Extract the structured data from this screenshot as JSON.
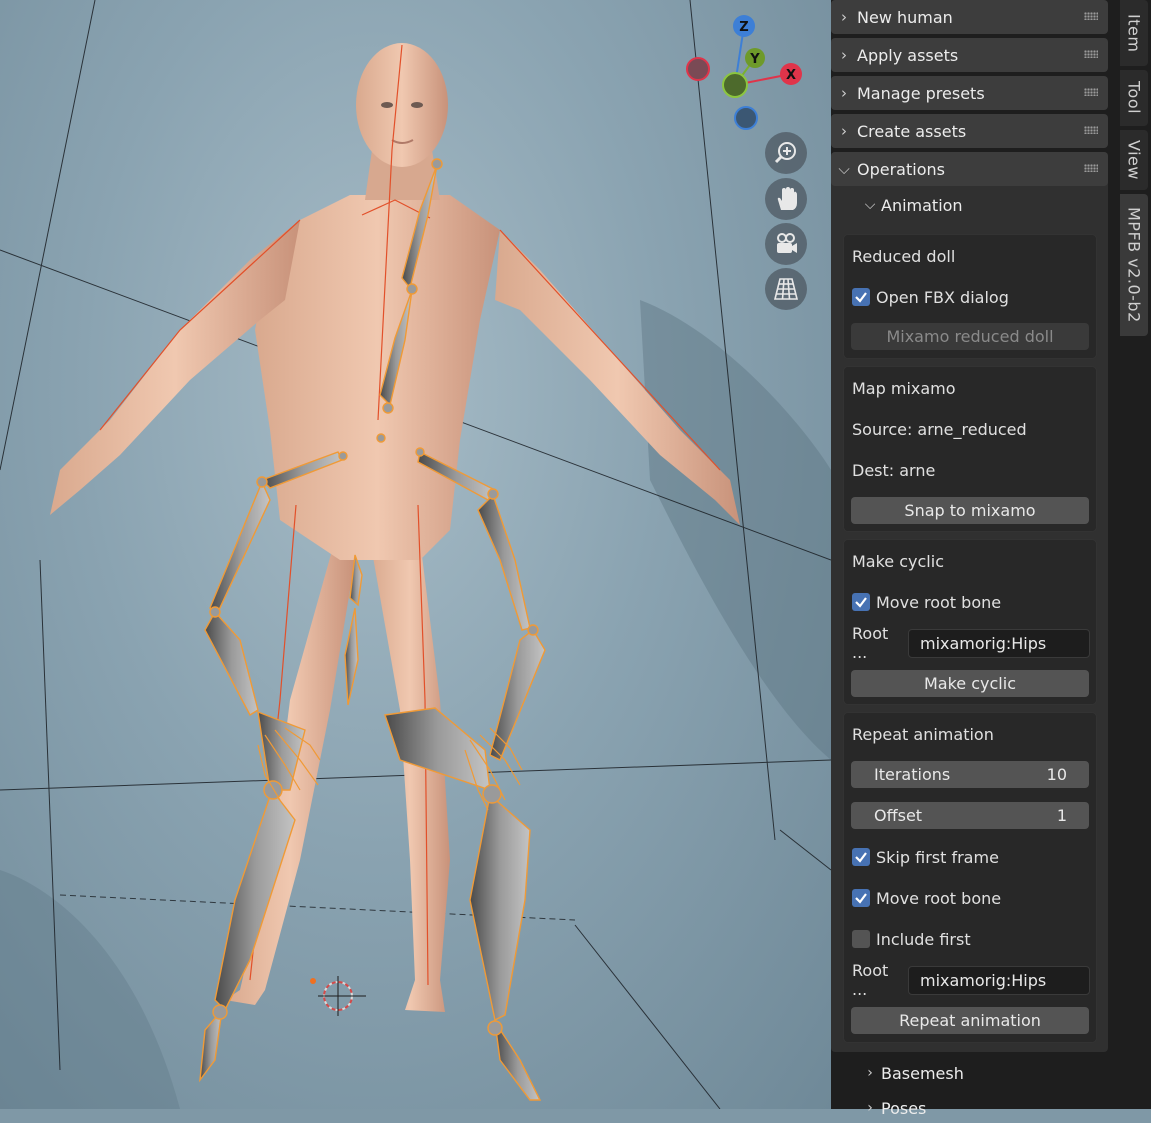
{
  "viewport": {
    "gizmo": {
      "z": "Z",
      "y": "Y",
      "x": "X"
    },
    "nav_icons": [
      "zoom-icon",
      "hand-pan-icon",
      "camera-icon",
      "grid-perspective-icon"
    ]
  },
  "panel": {
    "sections": {
      "new_human": "New human",
      "apply_assets": "Apply assets",
      "manage_presets": "Manage presets",
      "create_assets": "Create assets",
      "operations": "Operations"
    },
    "animation": {
      "label": "Animation",
      "reduced_doll": {
        "title": "Reduced doll",
        "open_fbx": "Open FBX dialog",
        "open_fbx_checked": true,
        "button": "Mixamo reduced doll"
      },
      "map_mixamo": {
        "title": "Map mixamo",
        "source": "Source: arne_reduced",
        "dest": "Dest: arne",
        "button": "Snap to mixamo"
      },
      "make_cyclic": {
        "title": "Make cyclic",
        "move_root": "Move root bone",
        "move_root_checked": true,
        "root_label": "Root ...",
        "root_value": "mixamorig:Hips",
        "button": "Make cyclic"
      },
      "repeat_animation": {
        "title": "Repeat animation",
        "iterations_label": "Iterations",
        "iterations_value": "10",
        "offset_label": "Offset",
        "offset_value": "1",
        "skip_first": "Skip first frame",
        "skip_first_checked": true,
        "move_root": "Move root bone",
        "move_root_checked": true,
        "include_first": "Include first",
        "include_first_checked": false,
        "root_label": "Root ...",
        "root_value": "mixamorig:Hips",
        "button": "Repeat animation"
      }
    },
    "basemesh": "Basemesh",
    "poses": "Poses"
  },
  "tabs": [
    "Item",
    "Tool",
    "View",
    "MPFB v2.0-b2"
  ]
}
